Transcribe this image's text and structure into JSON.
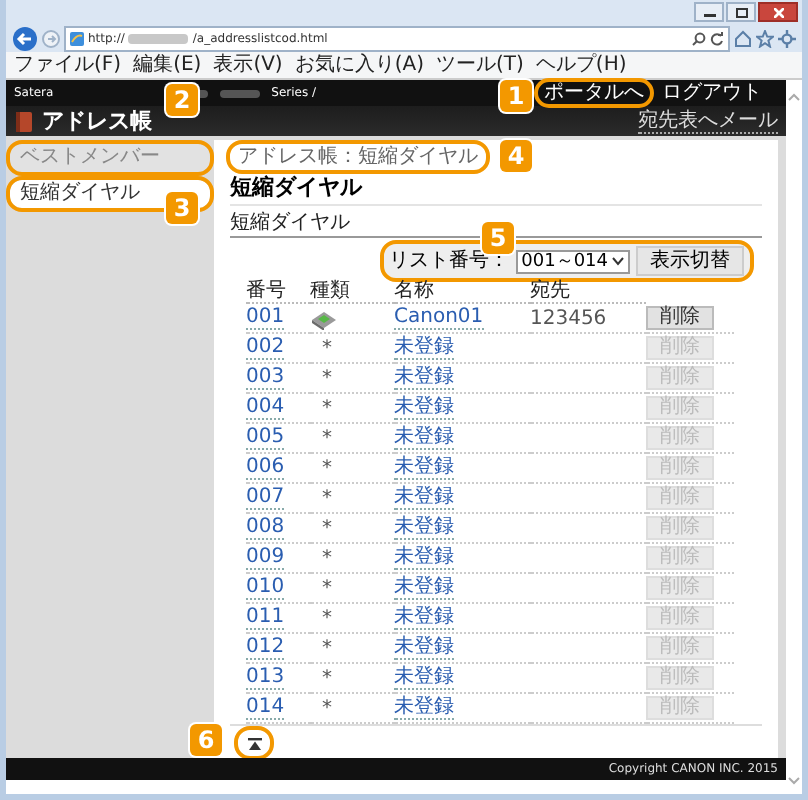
{
  "browser": {
    "url_start": "http://",
    "url_end": "/a_addresslistcod.html",
    "menu": [
      "ファイル(F)",
      "編集(E)",
      "表示(V)",
      "お気に入り(A)",
      "ツール(T)",
      "ヘルプ(H)"
    ]
  },
  "header": {
    "brand": "Satera",
    "series": "Series /",
    "portal_button": {
      "label": "ポータルへ",
      "highlighted": true
    },
    "logout": "ログアウト",
    "app_title": "アドレス帳",
    "mail_link": "宛先表へメール"
  },
  "sidebar": {
    "items": [
      {
        "label": "ベストメンバー",
        "selected": false,
        "highlighted": true
      },
      {
        "label": "短縮ダイヤル",
        "selected": true,
        "highlighted": true
      }
    ]
  },
  "main": {
    "breadcrumb": {
      "text": "アドレス帳：短縮ダイヤル",
      "highlighted": true
    },
    "title": "短縮ダイヤル",
    "subtitle": "短縮ダイヤル",
    "list_select": {
      "label": "リスト番号：",
      "value": "001～014",
      "button": "表示切替",
      "highlighted": true
    },
    "table": {
      "columns": [
        "番号",
        "種類",
        "名称",
        "宛先"
      ],
      "rows": [
        {
          "number": "001",
          "kind": "registered",
          "name": "Canon01",
          "destination": "123456",
          "delete": "削除",
          "delete_disabled": false
        },
        {
          "number": "002",
          "kind": "unregistered",
          "type": "*",
          "name": "未登録",
          "delete": "削除",
          "delete_disabled": true
        },
        {
          "number": "003",
          "kind": "unregistered",
          "type": "*",
          "name": "未登録",
          "delete": "削除",
          "delete_disabled": true
        },
        {
          "number": "004",
          "kind": "unregistered",
          "type": "*",
          "name": "未登録",
          "delete": "削除",
          "delete_disabled": true
        },
        {
          "number": "005",
          "kind": "unregistered",
          "type": "*",
          "name": "未登録",
          "delete": "削除",
          "delete_disabled": true
        },
        {
          "number": "006",
          "kind": "unregistered",
          "type": "*",
          "name": "未登録",
          "delete": "削除",
          "delete_disabled": true
        },
        {
          "number": "007",
          "kind": "unregistered",
          "type": "*",
          "name": "未登録",
          "delete": "削除",
          "delete_disabled": true
        },
        {
          "number": "008",
          "kind": "unregistered",
          "type": "*",
          "name": "未登録",
          "delete": "削除",
          "delete_disabled": true
        },
        {
          "number": "009",
          "kind": "unregistered",
          "type": "*",
          "name": "未登録",
          "delete": "削除",
          "delete_disabled": true
        },
        {
          "number": "010",
          "kind": "unregistered",
          "type": "*",
          "name": "未登録",
          "delete": "削除",
          "delete_disabled": true
        },
        {
          "number": "011",
          "kind": "unregistered",
          "type": "*",
          "name": "未登録",
          "delete": "削除",
          "delete_disabled": true
        },
        {
          "number": "012",
          "kind": "unregistered",
          "type": "*",
          "name": "未登録",
          "delete": "削除",
          "delete_disabled": true
        },
        {
          "number": "013",
          "kind": "unregistered",
          "type": "*",
          "name": "未登録",
          "delete": "削除",
          "delete_disabled": true
        },
        {
          "number": "014",
          "kind": "unregistered",
          "type": "*",
          "name": "未登録",
          "delete": "削除",
          "delete_disabled": true
        }
      ]
    },
    "top_button": {
      "highlighted": true
    }
  },
  "footer": "Copyright CANON INC. 2015",
  "callouts": [
    "1",
    "2",
    "3",
    "4",
    "5",
    "6"
  ]
}
